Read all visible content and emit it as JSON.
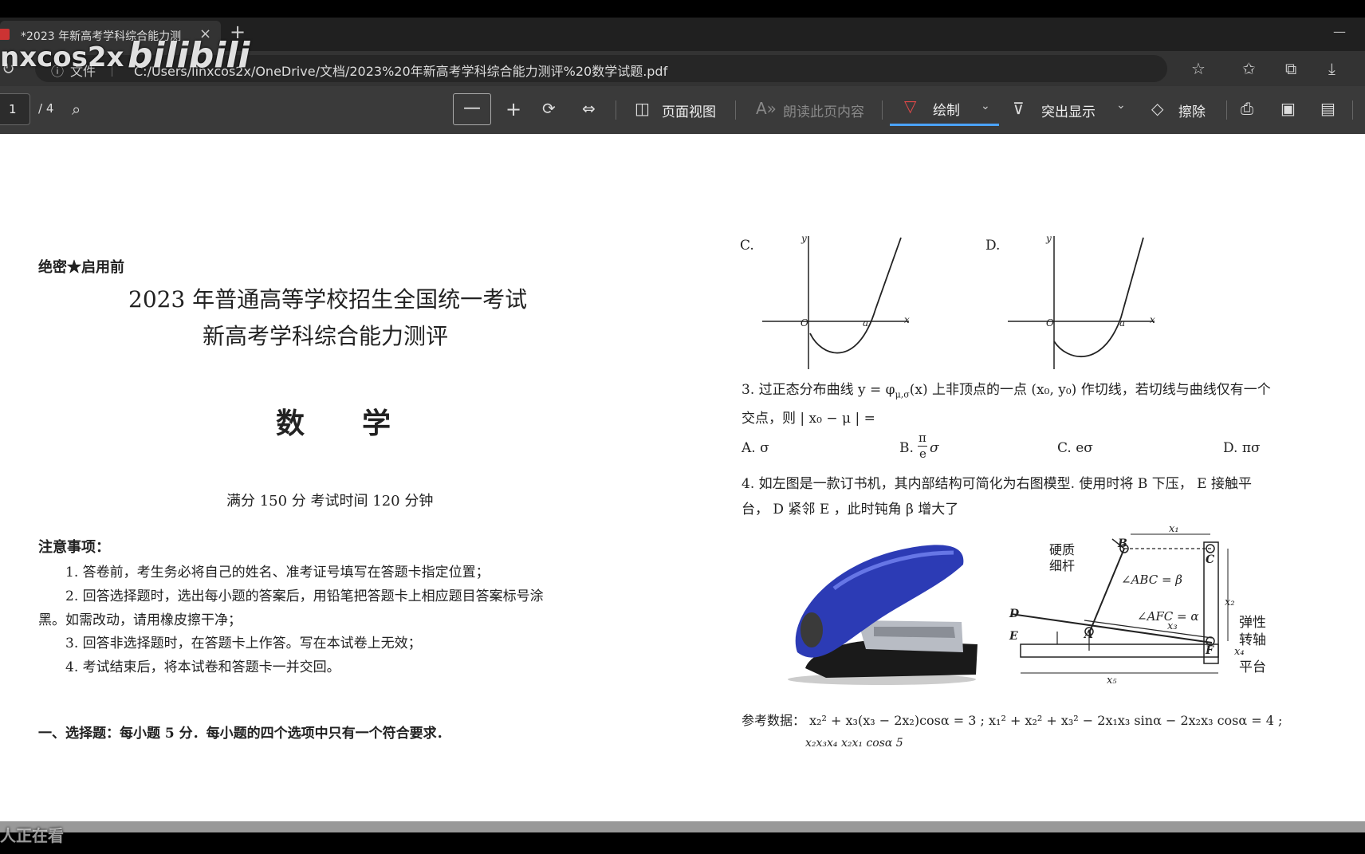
{
  "browser": {
    "tab_title": "*2023 年新高考学科综合能力测",
    "tab_close": "×",
    "new_tab": "+",
    "minimize": "—",
    "file_label": "文件",
    "address": "C:/Users/linxcos2x/OneDrive/文档/2023%20年新高考学科综合能力测评%20数学试题.pdf"
  },
  "watermark": {
    "user": "nxcos2x",
    "logo": "bilibili",
    "viewers": "人正在看"
  },
  "pdf_toolbar": {
    "page_number": "1",
    "page_total": "/ 4",
    "zoom_out": "—",
    "zoom_in": "+",
    "page_view": "页面视图",
    "read_aloud": "朗读此页内容",
    "draw": "绘制",
    "highlight": "突出显示",
    "erase": "擦除"
  },
  "left_page": {
    "secret": "绝密★启用前",
    "title1": "2023 年普通高等学校招生全国统一考试",
    "title2": "新高考学科综合能力测评",
    "subject": "数　　学",
    "score_time": "满分 150 分  考试时间 120 分钟",
    "notice_title": "注意事项：",
    "notices": [
      "1. 答卷前，考生务必将自己的姓名、准考证号填写在答题卡指定位置；",
      "2. 回答选择题时，选出每小题的答案后，用铅笔把答题卡上相应题目答案标号涂",
      "黑。如需改动，请用橡皮擦干净；",
      "3. 回答非选择题时，在答题卡上作答。写在本试卷上无效；",
      "4. 考试结束后，将本试卷和答题卡一并交回。"
    ],
    "section1": "一、选择题：每小题 5 分．每小题的四个选项中只有一个符合要求．"
  },
  "right_page": {
    "graph_c_label": "C.",
    "graph_d_label": "D.",
    "axis_y": "y",
    "axis_x": "x",
    "origin": "O",
    "root": "a",
    "q3_line1": "3. 过正态分布曲线 y = φ",
    "q3_sub": "μ,σ",
    "q3_line1b": "(x) 上非顶点的一点 (x₀, y₀) 作切线，若切线与曲线仅有一个",
    "q3_line2": "交点，则 | x₀ − μ | =",
    "q3_options": [
      "A. σ",
      "B.",
      "C. eσ",
      "D. πσ"
    ],
    "q3_b_num": "π",
    "q3_b_den": "e",
    "q3_b_sigma": "σ",
    "q4_line1": "4. 如左图是一款订书机，其内部结构可简化为右图模型. 使用时将 B 下压， E 接触平",
    "q4_line2": "台， D 紧邻 E ，此时钝角 β 增大了",
    "diagram": {
      "rod": "硬质",
      "rod2": "细杆",
      "angle_abc": "∠ABC = β",
      "angle_afc": "∠AFC = α",
      "spring": "弹性",
      "spring2": "转轴",
      "platform": "平台",
      "B": "B",
      "C": "C",
      "D": "D",
      "E": "E",
      "A": "A",
      "F": "F",
      "x1": "x₁",
      "x2": "x₂",
      "x3": "x₃",
      "x4": "x₄",
      "x5": "x₅"
    },
    "ref_data": "参考数据： x₂² + x₃(x₃ − 2x₂)cosα = 3 ;  x₁² + x₂² + x₃² − 2x₁x₃ sinα − 2x₂x₃ cosα = 4 ;",
    "cut_line": "x₂x₃x₄      x₂x₁ cosα         5"
  }
}
